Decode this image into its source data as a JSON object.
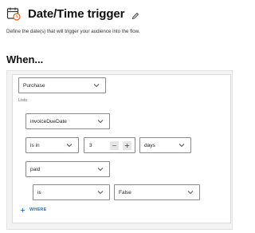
{
  "header": {
    "title": "Date/Time trigger",
    "subtitle": "Define the date(s) that will trigger your audience into the flow.",
    "section_heading": "When..."
  },
  "conditions": {
    "event_select": "Purchase",
    "lists_label": "Lists",
    "property_select": "invoiceDueDate",
    "operator_select": "is in",
    "amount_value": "3",
    "unit_select": "days",
    "filter_property_select": "paid",
    "filter_operator_select": "is",
    "filter_value_select": "False",
    "add_where_label": "WHERE"
  },
  "icons": {
    "title_icon": "calendar-clock-icon",
    "edit_icon": "pencil-icon",
    "decrement_icon": "minus-icon",
    "increment_icon": "plus-icon",
    "dropdown_icon": "chevron-down-icon",
    "add_icon": "plus-icon"
  },
  "colors": {
    "accent": "#1a6fd6",
    "calendar_alert": "#e8590c"
  }
}
